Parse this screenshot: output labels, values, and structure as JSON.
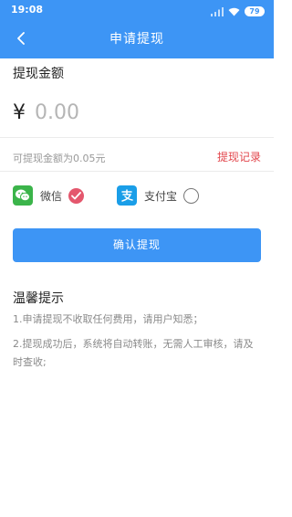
{
  "status_bar": {
    "time": "19:08",
    "battery": "79",
    "icons": [
      "signal-icon",
      "wifi-icon",
      "battery-icon"
    ]
  },
  "nav": {
    "title": "申请提现",
    "back_icon": "chevron-left-icon"
  },
  "form": {
    "amount_label": "提现金额",
    "currency_symbol": "¥",
    "amount_placeholder": "0.00",
    "available_text": "可提现金额为0.05元",
    "record_link": "提现记录"
  },
  "payment_methods": [
    {
      "label": "微信",
      "icon": "wechat-icon",
      "selected": true
    },
    {
      "label": "支付宝",
      "icon": "alipay-icon",
      "selected": false
    }
  ],
  "confirm_button": "确认提现",
  "tips": {
    "title": "温馨提示",
    "items": [
      "1.申请提现不收取任何费用，请用户知悉；",
      "2.提现成功后，系统将自动转账，无需人工审核，请及时查收;"
    ]
  },
  "colors": {
    "primary": "#3d95f5",
    "link_red": "#e2454b",
    "radio_checked": "#e4576d",
    "wechat_green": "#3bb44a",
    "alipay_blue": "#1a9ee8"
  }
}
